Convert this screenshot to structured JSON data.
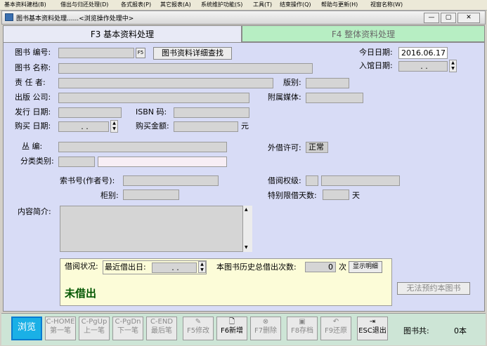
{
  "menu": [
    "基本资料建档(B)",
    "借出与归还处理(D)",
    "各式报表(P)",
    "其它报表(A)",
    "系统维护功能(S)",
    "工具(T)",
    "结束操作(Q)",
    "帮助与更新(H)",
    "视窗名称(W)"
  ],
  "window": {
    "title": "图书基本资料处理......<浏览操作处理中>",
    "minimize": "—",
    "restore": "▢",
    "close": "✕"
  },
  "tabs": {
    "basic": "F3 基本资料处理",
    "overall": "F4 整体资料处理"
  },
  "form": {
    "book_no_label": "图书 编号:",
    "f5_tag": "F5",
    "detail_search_button": "图书资料详细查找",
    "today_label": "今日日期:",
    "today_value": "2016.06.17",
    "entry_date_label": "入馆日期:",
    "entry_date_value": ". .",
    "title_label": "图书 名称:",
    "author_label": "责 任 者:",
    "edition_label": "版别:",
    "publisher_label": "出版 公司:",
    "media_label": "附属媒体:",
    "issue_date_label": "发行 日期:",
    "isbn_label": "ISBN 码:",
    "purchase_date_label": "购买 日期:",
    "purchase_date_value": ". .",
    "amount_label": "购买金额:",
    "currency_unit": "元",
    "series_label": "丛 编:",
    "lend_permit_label": "外借许可:",
    "lend_permit_value": "正常",
    "category_label": "分类类别:",
    "call_no_label": "索书号(作者号):",
    "borrow_level_label": "借阅权级:",
    "cabinet_label": "柜别:",
    "special_days_label": "特别限借天数:",
    "days_unit": "天",
    "summary_label": "内容简介:"
  },
  "borrow": {
    "status_label": "借阅状况:",
    "last_borrow_label": "最近借出日:",
    "last_borrow_value": ". .",
    "history_label": "本图书历史总借出次数:",
    "history_count": "0",
    "times_unit": "次",
    "show_detail_button": "显示明细",
    "status_value": "未借出"
  },
  "reserve_button": "无法预约本图书",
  "toolbar": {
    "browse": "浏览",
    "first": [
      "C-HOME",
      "第一笔"
    ],
    "prev": [
      "C-PgUp",
      "上一笔"
    ],
    "next": [
      "C-PgDn",
      "下一笔"
    ],
    "last": [
      "C-END",
      "最后笔"
    ],
    "modify": "F5修改",
    "add": "F6新增",
    "delete": "F7删除",
    "save": "F8存档",
    "restore": "F9还原",
    "exit": "ESC退出",
    "book_count_label": "图书共:",
    "book_count_value": "0本"
  },
  "icons": {
    "window": "book-icon",
    "exit": "door-exit-icon",
    "modify": "pencil-icon",
    "add": "new-page-icon",
    "delete": "delete-icon",
    "save": "save-disk-icon",
    "restore": "undo-icon"
  },
  "colors": {
    "panel": "#d8dcf6",
    "active_tab": "#e8eaf6",
    "inactive_tab": "#b7eec3",
    "toolbar": "#cde5d6",
    "browse_button": "#1ab0e6",
    "borrow_box": "#fcfcd8",
    "status_text": "#005500"
  }
}
